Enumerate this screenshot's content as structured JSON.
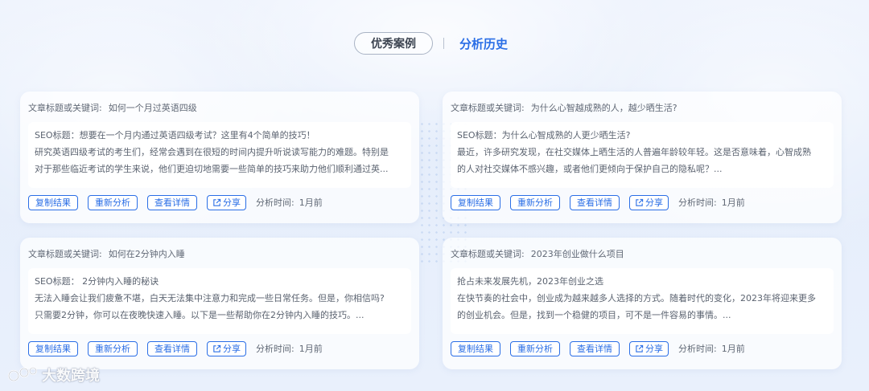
{
  "tabs": {
    "items": [
      {
        "label": "优秀案例"
      },
      {
        "label": "分析历史"
      }
    ],
    "separator": "|"
  },
  "card_labels": {
    "keyword_label": "文章标题或关键词:",
    "copy": "复制结果",
    "reanalyze": "重新分析",
    "details": "查看详情",
    "share": "分享",
    "time_label": "分析时间:"
  },
  "cards": [
    {
      "keyword": "如何一个月过英语四级",
      "lines": [
        "SEO标题：想要在一个月内通过英语四级考试？这里有4个简单的技巧！",
        "研究英语四级考试的考生们，经常会遇到在很短的时间内提升听说读写能力的难题。特别是",
        "对于那些临近考试的学生来说，他们更迫切地需要一些简单的技巧来助力他们顺利通过英..."
      ],
      "time": "1月前"
    },
    {
      "keyword": "为什么心智越成熟的人，越少晒生活?",
      "lines": [
        "SEO标题：为什么心智成熟的人更少晒生活?",
        "最近，许多研究发现，在社交媒体上晒生活的人普遍年龄较年轻。这是否意味着，心智成熟",
        "的人对社交媒体不感兴趣，或者他们更倾向于保护自己的隐私呢？..."
      ],
      "time": "1月前"
    },
    {
      "keyword": "如何在2分钟内入睡",
      "lines": [
        "SEO标题：  2分钟内入睡的秘诀",
        "无法入睡会让我们疲惫不堪，白天无法集中注意力和完成一些日常任务。但是，你相信吗?",
        "只需要2分钟，你可以在夜晚快速入睡。以下是一些帮助你在2分钟内入睡的技巧。..."
      ],
      "time": "1月前"
    },
    {
      "keyword": "2023年创业做什么项目",
      "lines": [
        "抢占未来发展先机，2023年创业之选",
        "在快节奏的社会中，创业成为越来越多人选择的方式。随着时代的变化，2023年将迎来更多",
        "的创业机会。但是，找到一个稳健的项目，可不是一件容易的事情。..."
      ],
      "time": "1月前"
    }
  ],
  "watermark": {
    "text": "大数跨境"
  },
  "colors": {
    "accent": "#2a6ee6",
    "background": "#e9f0fc"
  }
}
